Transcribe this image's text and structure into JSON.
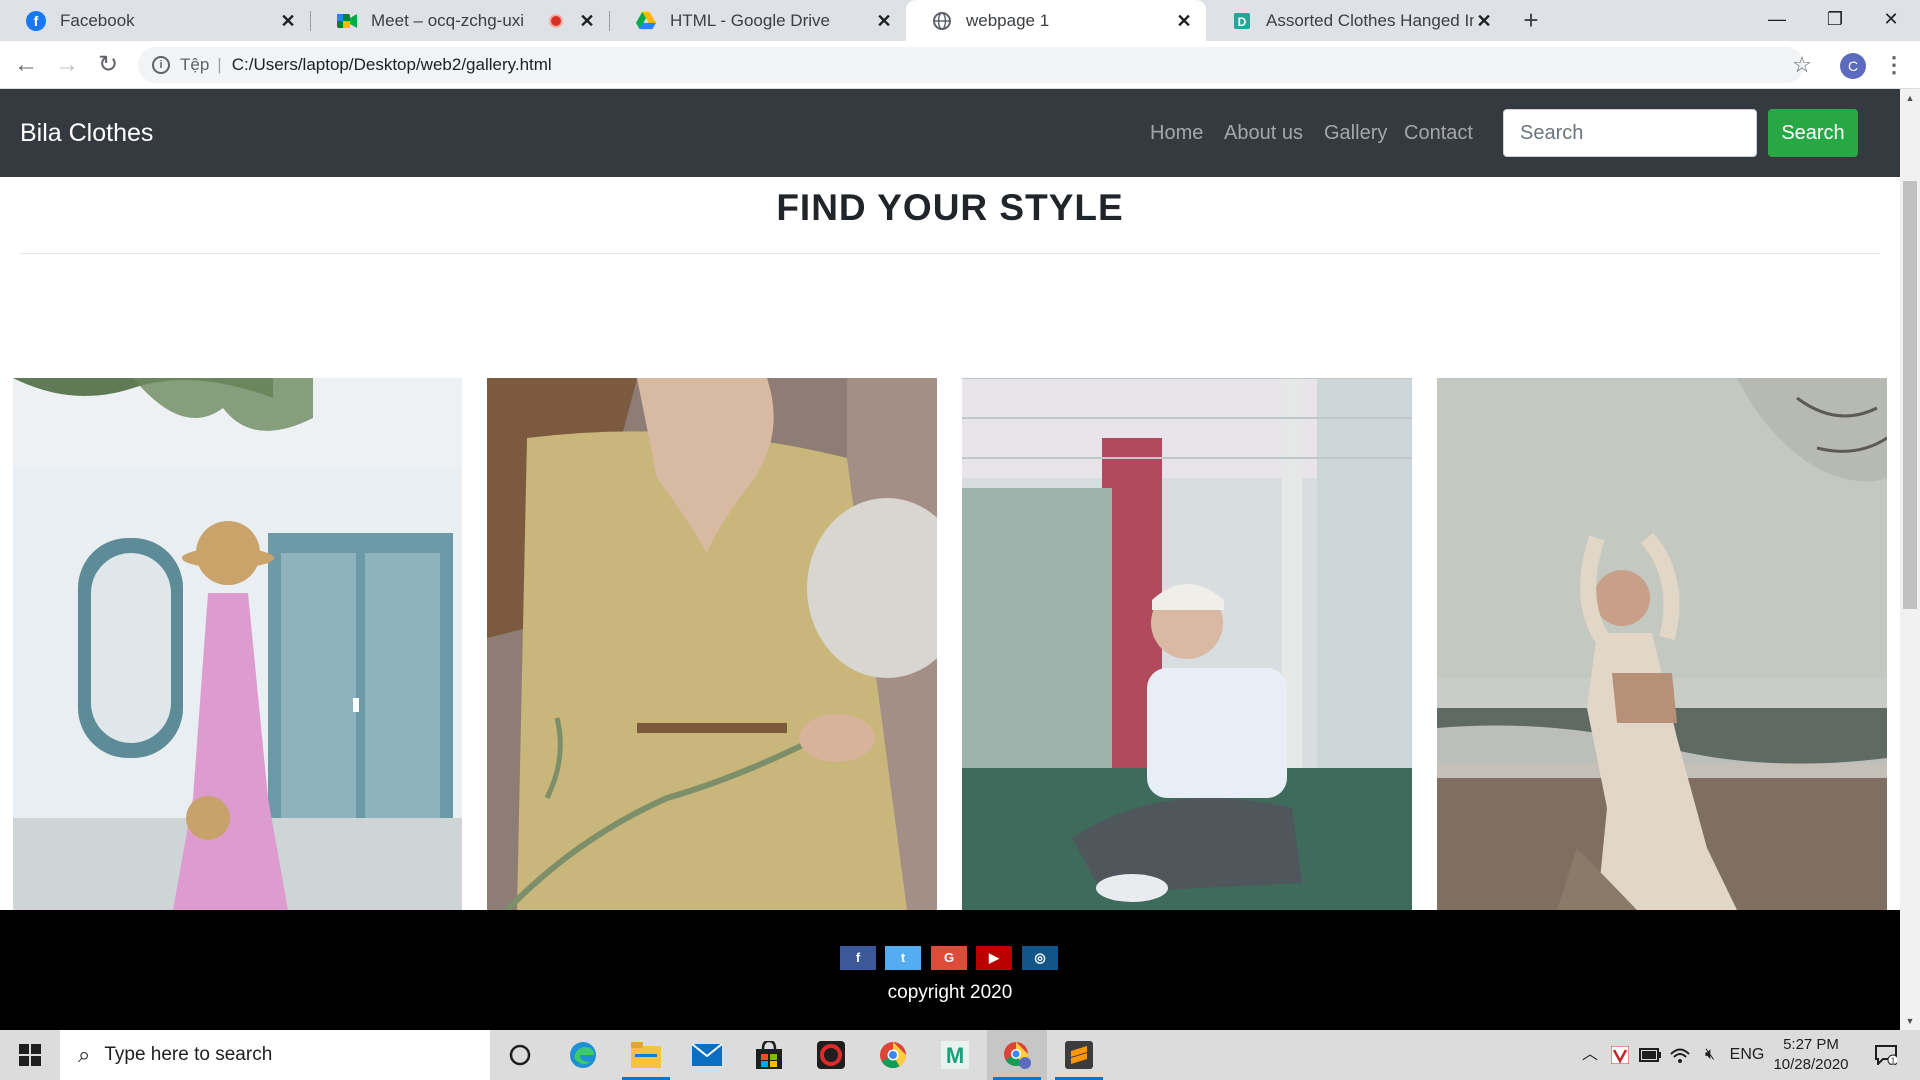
{
  "browser": {
    "tabs": [
      {
        "title": "Facebook",
        "icon": "facebook-icon"
      },
      {
        "title": "Meet – ocq-zchg-uxi",
        "icon": "google-meet-icon"
      },
      {
        "title": "HTML - Google Drive",
        "icon": "google-drive-icon"
      },
      {
        "title": "webpage 1",
        "icon": "globe-icon"
      },
      {
        "title": "Assorted Clothes Hanged Inside C",
        "icon": "document-icon"
      }
    ],
    "address": {
      "scheme_label": "Tệp",
      "url": "C:/Users/laptop/Desktop/web2/gallery.html"
    },
    "profile_initial": "C"
  },
  "site": {
    "brand": "Bila Clothes",
    "nav": [
      "Home",
      "About us",
      "Gallery",
      "Contact"
    ],
    "search_placeholder": "Search",
    "search_button": "Search",
    "heading": "FIND YOUR STYLE",
    "gallery": [
      {
        "subject": "woman in pink dress with straw hat by blue door"
      },
      {
        "subject": "woman in floral yellow dress"
      },
      {
        "subject": "woman sitting by goal net in white t-shirt"
      },
      {
        "subject": "woman posing on beach in beige outfit"
      }
    ],
    "social_buttons": [
      {
        "label": "f",
        "color": "#3b5998",
        "icon": "facebook-icon"
      },
      {
        "label": "t",
        "color": "#55acee",
        "icon": "twitter-icon"
      },
      {
        "label": "G",
        "color": "#dd4b39",
        "icon": "google-icon"
      },
      {
        "label": "▶",
        "color": "#bb0000",
        "icon": "youtube-icon"
      },
      {
        "label": "◎",
        "color": "#125688",
        "icon": "instagram-icon"
      }
    ],
    "copyright": "copyright 2020"
  },
  "taskbar": {
    "search_placeholder": "Type here to search",
    "language": "ENG",
    "time": "5:27 PM",
    "date": "10/28/2020",
    "notification_count": "1"
  }
}
